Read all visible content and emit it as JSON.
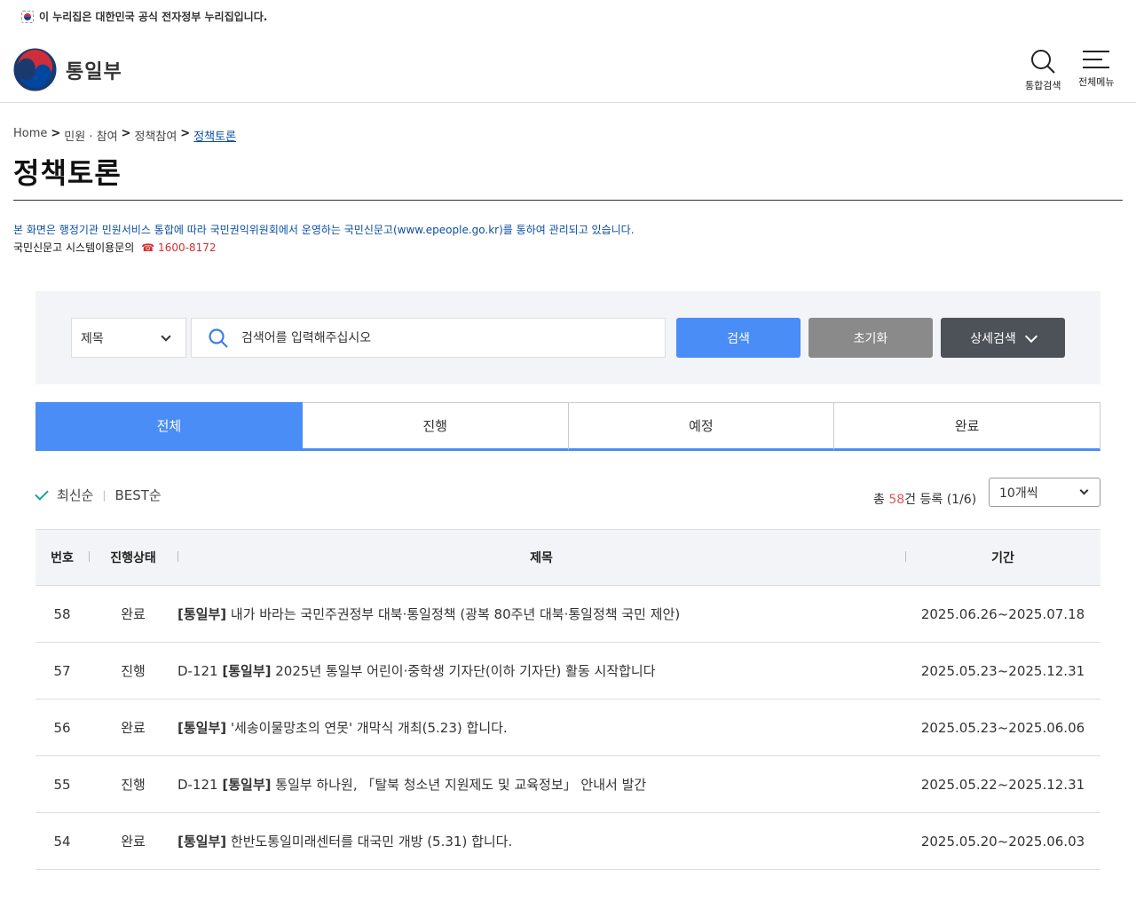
{
  "gov_banner": "이 누리집은 대한민국 공식 전자정부 누리집입니다.",
  "logo": {
    "text": "통일부"
  },
  "header": {
    "search_label": "통합검색",
    "menu_label": "전체메뉴"
  },
  "breadcrumb": {
    "home": "Home",
    "sep": ">",
    "level1": "민원 · 참여",
    "level2": "정책참여",
    "current": "정책토론"
  },
  "page_title": "정책토론",
  "notice": "본 화면은 행정기관 민원서비스 통합에 따라 국민권익위원회에서 운영하는 국민신문고(www.epeople.go.kr)를 통하여 관리되고 있습니다.",
  "contact": {
    "label": "국민신문고 시스템이용문의",
    "phone": "☎ 1600-8172"
  },
  "search": {
    "field_select": "제목",
    "placeholder": "검색어를 입력해주십시오",
    "search_btn": "검색",
    "reset_btn": "초기화",
    "detail_btn": "상세검색"
  },
  "tabs": [
    {
      "label": "전체",
      "active": true
    },
    {
      "label": "진행"
    },
    {
      "label": "예정"
    },
    {
      "label": "완료"
    }
  ],
  "sort": {
    "latest": "최신순",
    "best": "BEST순"
  },
  "total": {
    "prefix": "총 ",
    "count": "58",
    "suffix": "건 등록 (1/6)"
  },
  "page_size": "10개씩",
  "table": {
    "headers": {
      "no": "번호",
      "status": "진행상태",
      "title": "제목",
      "period": "기간"
    },
    "rows": [
      {
        "no": "58",
        "status": "완료",
        "dday": "",
        "tag": "[통일부]",
        "title": " 내가 바라는 국민주권정부 대북·통일정책 (광복 80주년 대북·통일정책 국민 제안)",
        "period": "2025.06.26~2025.07.18"
      },
      {
        "no": "57",
        "status": "진행",
        "dday": "D-121 ",
        "tag": "[통일부]",
        "title": " 2025년 통일부 어린이·중학생 기자단(이하 기자단) 활동 시작합니다",
        "period": "2025.05.23~2025.12.31"
      },
      {
        "no": "56",
        "status": "완료",
        "dday": "",
        "tag": "[통일부]",
        "title": " '세송이물망초의 연못' 개막식 개최(5.23) 합니다.",
        "period": "2025.05.23~2025.06.06"
      },
      {
        "no": "55",
        "status": "진행",
        "dday": "D-121 ",
        "tag": "[통일부]",
        "title": " 통일부 하나원, 「탈북 청소년 지원제도 및 교육정보」 안내서 발간",
        "period": "2025.05.22~2025.12.31"
      },
      {
        "no": "54",
        "status": "완료",
        "dday": "",
        "tag": "[통일부]",
        "title": " 한반도통일미래센터를 대국민 개방 (5.31) 합니다.",
        "period": "2025.05.20~2025.06.03"
      }
    ]
  },
  "colors": {
    "accent": "#4a8df6",
    "link": "#0b4ea2",
    "count_red": "#e05555",
    "check_green": "#1aa58b"
  }
}
